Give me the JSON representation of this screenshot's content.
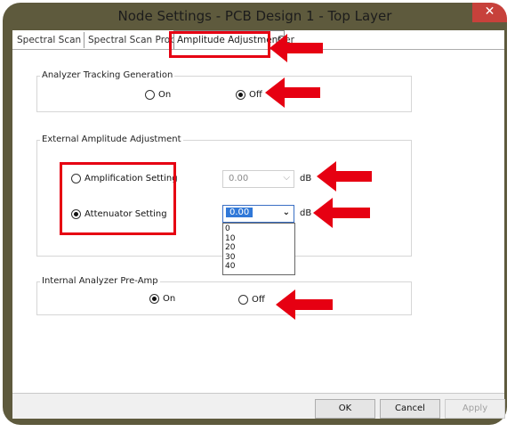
{
  "window": {
    "title": "Node Settings - PCB Design 1 - Top Layer",
    "close_glyph": "✕"
  },
  "tabs": [
    {
      "label": "Spectral Scan"
    },
    {
      "label": "Spectral Scan Probes"
    },
    {
      "label": "Amplitude Adjustment",
      "selected": true
    },
    {
      "label": "Ger"
    }
  ],
  "tracking": {
    "label": "Analyzer Tracking Generation",
    "on": "On",
    "off": "Off",
    "selected": "Off"
  },
  "external": {
    "label": "External Amplitude Adjustment",
    "amplification_label": "Amplification Setting",
    "amplification_value": "0.00",
    "attenuator_label": "Attenuator Setting",
    "attenuator_value": "0.00",
    "selected": "Attenuator Setting",
    "unit": "dB",
    "dropdown_options": [
      "0",
      "10",
      "20",
      "30",
      "40"
    ]
  },
  "preamp": {
    "label": "Internal Analyzer Pre-Amp",
    "on": "On",
    "off": "Off",
    "selected": "On"
  },
  "buttons": {
    "ok": "OK",
    "cancel": "Cancel",
    "apply": "Apply"
  },
  "colors": {
    "frame": "#5e5a3d",
    "highlight": "#e60012",
    "selection": "#3078d8",
    "close": "#c7413b"
  },
  "icons": {
    "dropdown": "chevron-down-icon",
    "close": "close-icon"
  }
}
